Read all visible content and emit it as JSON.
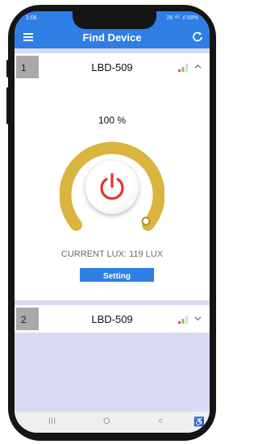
{
  "status_bar": {
    "time": "1:06",
    "right": "26 ⁴ᴳ .ıl 59%"
  },
  "app_bar": {
    "title": "Find Device",
    "menu_icon": "hamburger-menu-icon",
    "refresh_icon": "refresh-icon"
  },
  "devices": [
    {
      "index": "1",
      "name": "LBD-509",
      "expanded": true,
      "brightness": "100 %",
      "current_lux": "CURRENT LUX: 119 LUX",
      "setting_label": "Setting"
    },
    {
      "index": "2",
      "name": "LBD-509",
      "expanded": false
    }
  ],
  "nav_bar": {
    "recents": "III",
    "home": "O",
    "back": "<",
    "accessibility": "♿"
  },
  "colors": {
    "primary": "#2f7ee5",
    "gauge": "#d9b43e",
    "power": "#e5332a",
    "background": "#d9dbf2"
  }
}
